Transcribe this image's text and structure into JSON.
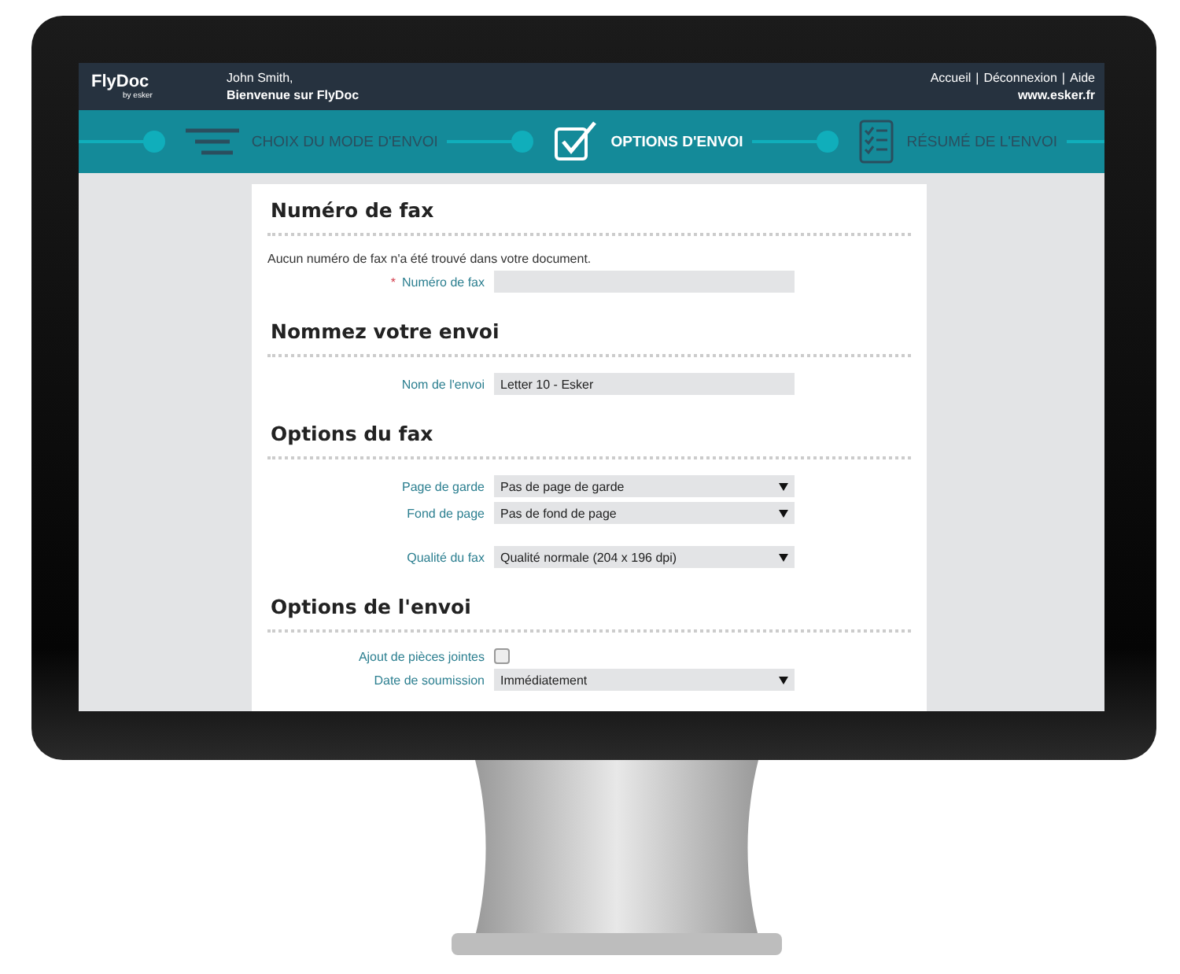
{
  "header": {
    "logo": "FlyDoc",
    "logo_sub": "by esker",
    "user": "John Smith,",
    "welcome": "Bienvenue sur FlyDoc",
    "links": [
      "Accueil",
      "Déconnexion",
      "Aide"
    ],
    "separator": "|",
    "site": "www.esker.fr"
  },
  "steps": [
    {
      "kind": "list",
      "label": "CHOIX DU MODE D'ENVOI",
      "selected": false
    },
    {
      "kind": "check",
      "label": "OPTIONS D'ENVOI",
      "selected": true
    },
    {
      "kind": "checklist",
      "label": "RÉSUMÉ DE L'ENVOI",
      "selected": false
    }
  ],
  "sections": [
    {
      "title": "Numéro de fax",
      "groups": [
        [
          {
            "kind": "note",
            "text": "Aucun numéro de fax n'a été trouvé dans votre document."
          },
          {
            "kind": "text",
            "label": "Numéro de fax",
            "required_mark": "*"
          }
        ]
      ]
    },
    {
      "title": "Nommez votre envoi",
      "groups": [
        [
          {
            "kind": "text",
            "label": "Nom de l'envoi",
            "value": "Letter 10 - Esker"
          }
        ]
      ]
    },
    {
      "title": "Options du fax",
      "groups": [
        [
          {
            "kind": "select",
            "label": "Page de garde",
            "value": "Pas de page de garde"
          },
          {
            "kind": "select",
            "label": "Fond de page",
            "value": "Pas de fond de page"
          }
        ],
        [
          {
            "kind": "select",
            "label": "Qualité du fax",
            "value": "Qualité normale (204 x 196 dpi)"
          }
        ]
      ]
    },
    {
      "title": "Options de l'envoi",
      "groups": [
        [
          {
            "kind": "checkbox",
            "label": "Ajout de pièces jointes",
            "checked": false
          },
          {
            "kind": "select",
            "label": "Date de soumission",
            "value": "Immédiatement"
          }
        ]
      ]
    }
  ]
}
